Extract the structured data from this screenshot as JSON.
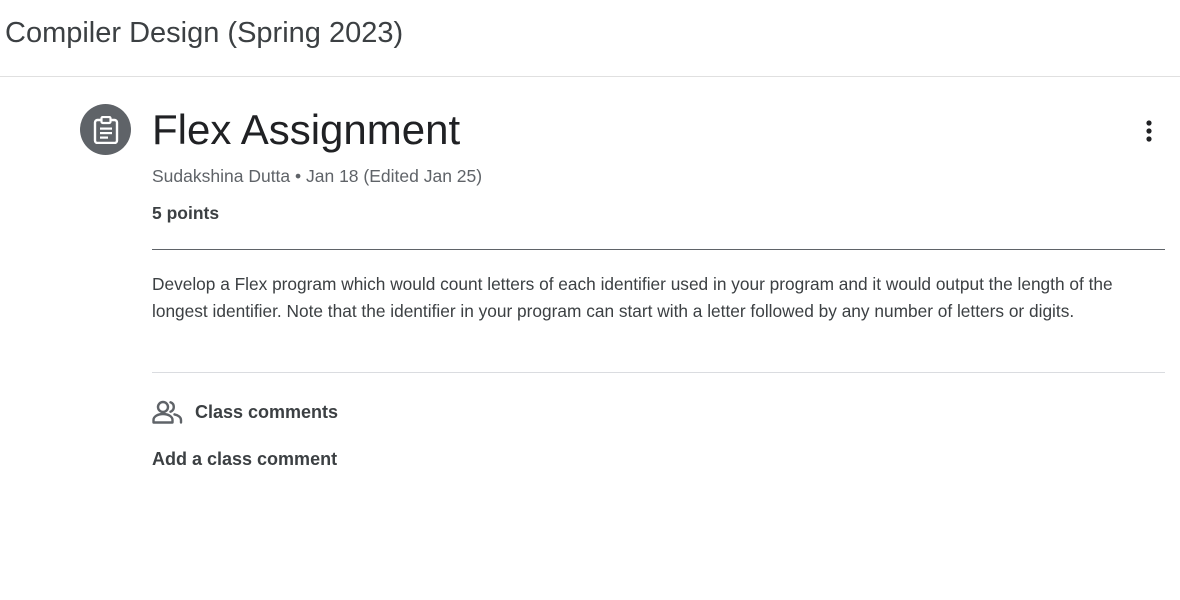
{
  "header": {
    "course_title": "Compiler Design (Spring 2023)"
  },
  "assignment": {
    "icon": "assignment-clipboard-icon",
    "title": "Flex Assignment",
    "meta": "Sudakshina Dutta • Jan 18 (Edited Jan 25)",
    "points": "5 points",
    "description": "Develop a Flex program which would count letters of each identifier used in your program and it would output the length of the longest identifier. Note that the identifier in your program can start with a letter followed by any number of letters or digits.",
    "more_icon": "more-vertical-icon"
  },
  "comments": {
    "icon": "people-icon",
    "label": "Class comments",
    "add_label": "Add a class comment"
  },
  "colors": {
    "icon_bg": "#5f6368",
    "text_primary": "#202124",
    "text_secondary": "#5f6368"
  }
}
